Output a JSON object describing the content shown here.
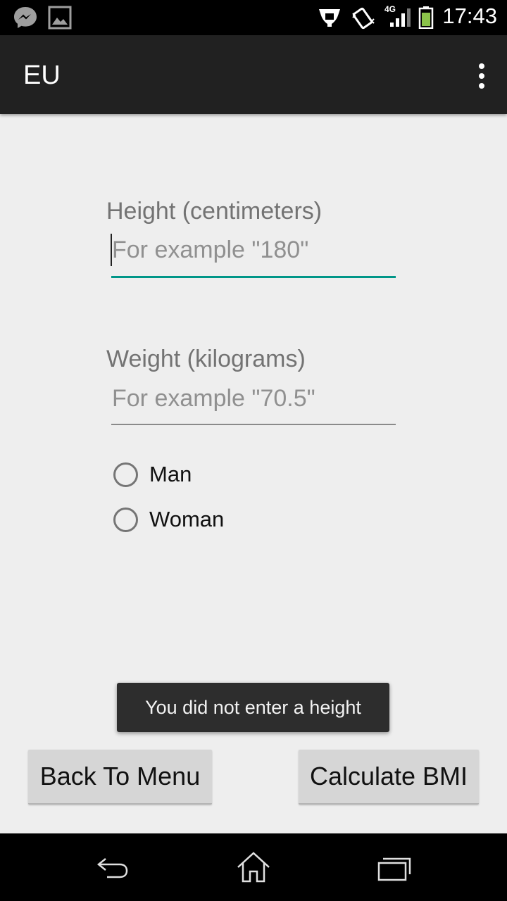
{
  "status_bar": {
    "time": "17:43",
    "network": "4G",
    "icons": [
      "messenger-icon",
      "image-icon",
      "nfc-icon",
      "vibrate-icon",
      "signal-icon",
      "battery-icon"
    ]
  },
  "app_bar": {
    "title": "EU",
    "overflow_icon": "more-vertical-icon"
  },
  "form": {
    "height": {
      "label": "Height (centimeters)",
      "placeholder": "For example \"180\"",
      "value": "",
      "focused": true
    },
    "weight": {
      "label": "Weight (kilograms)",
      "placeholder": "For example \"70.5\"",
      "value": ""
    },
    "gender": {
      "options": [
        "Man",
        "Woman"
      ],
      "selected": null
    }
  },
  "toast": {
    "message": "You did not enter a height"
  },
  "buttons": {
    "back": "Back To Menu",
    "calculate": "Calculate BMI"
  },
  "nav_bar": {
    "icons": [
      "back-icon",
      "home-icon",
      "recents-icon"
    ]
  },
  "colors": {
    "accent": "#009688",
    "app_bar": "#212121",
    "background": "#eeeeee",
    "toast": "#2d2d2d"
  }
}
